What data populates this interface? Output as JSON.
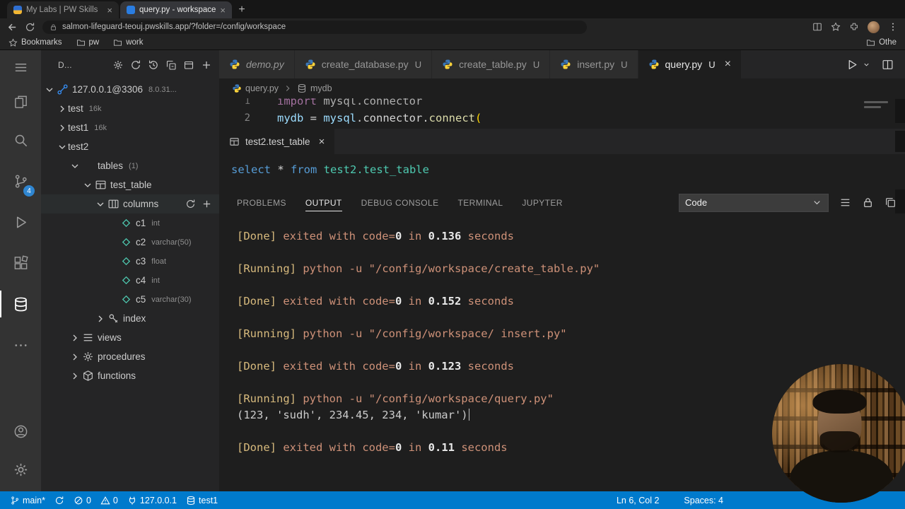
{
  "colors": {
    "statusbar": "#007acc",
    "badge": "#2f86d1",
    "keyword_blue": "#569cd6",
    "entity_teal": "#4ec9b0",
    "string_orange": "#ce9178",
    "tag_yellow": "#d7ba7d"
  },
  "browser": {
    "tabs": [
      {
        "title": "My Labs | PW Skills",
        "favicon": "pw",
        "active": false
      },
      {
        "title": "query.py - workspace - code-se",
        "favicon": "code",
        "active": true
      }
    ],
    "url": "salmon-lifeguard-teouj.pwskills.app/?folder=/config/workspace",
    "bookmarks": [
      {
        "label": "Bookmarks",
        "icon": "star"
      },
      {
        "label": "pw",
        "icon": "folder"
      },
      {
        "label": "work",
        "icon": "folder"
      },
      {
        "label": "Othe",
        "icon": "folder"
      }
    ]
  },
  "activity_bar": {
    "items": [
      {
        "name": "menu",
        "icon": "menu"
      },
      {
        "name": "explorer",
        "icon": "files"
      },
      {
        "name": "search",
        "icon": "search"
      },
      {
        "name": "source-control",
        "icon": "branch",
        "badge": "4"
      },
      {
        "name": "run-debug",
        "icon": "run"
      },
      {
        "name": "extensions",
        "icon": "extensions"
      },
      {
        "name": "database",
        "icon": "database",
        "active": true
      },
      {
        "name": "more",
        "icon": "more"
      }
    ],
    "bottom": [
      {
        "name": "account",
        "icon": "account"
      },
      {
        "name": "settings",
        "icon": "gear"
      }
    ]
  },
  "sidebar": {
    "title": "D...",
    "actions": [
      "gear",
      "refresh",
      "history",
      "collapse",
      "window",
      "add"
    ],
    "tree": [
      {
        "indent": 0,
        "chevron": "down",
        "icon": "connection",
        "label": "127.0.0.1@3306",
        "meta": "8.0.31..."
      },
      {
        "indent": 1,
        "chevron": "right",
        "label": "test",
        "meta": "16k"
      },
      {
        "indent": 1,
        "chevron": "right",
        "label": "test1",
        "meta": "16k"
      },
      {
        "indent": 1,
        "chevron": "down",
        "label": "test2"
      },
      {
        "indent": 2,
        "chevron": "down",
        "icon": "table-orange",
        "label": "tables",
        "meta": "(1)"
      },
      {
        "indent": 3,
        "chevron": "down",
        "icon": "table",
        "label": "test_table"
      },
      {
        "indent": 4,
        "chevron": "down",
        "icon": "columns",
        "label": "columns",
        "actions": [
          "refresh",
          "add"
        ],
        "selected": true
      },
      {
        "indent": 5,
        "icon": "field",
        "label": "c1",
        "meta": "int"
      },
      {
        "indent": 5,
        "icon": "field",
        "label": "c2",
        "meta": "varchar(50)"
      },
      {
        "indent": 5,
        "icon": "field",
        "label": "c3",
        "meta": "float"
      },
      {
        "indent": 5,
        "icon": "field",
        "label": "c4",
        "meta": "int"
      },
      {
        "indent": 5,
        "icon": "field",
        "label": "c5",
        "meta": "varchar(30)"
      },
      {
        "indent": 4,
        "chevron": "right",
        "icon": "key",
        "label": "index"
      },
      {
        "indent": 2,
        "chevron": "right",
        "icon": "list",
        "label": "views"
      },
      {
        "indent": 2,
        "chevron": "right",
        "icon": "gear",
        "label": "procedures"
      },
      {
        "indent": 2,
        "chevron": "right",
        "icon": "cube",
        "label": "functions"
      }
    ]
  },
  "editor": {
    "tabs": [
      {
        "name": "demo.py",
        "italic": true
      },
      {
        "name": "create_database.py",
        "flag": "U"
      },
      {
        "name": "create_table.py",
        "flag": "U"
      },
      {
        "name": "insert.py",
        "flag": "U"
      },
      {
        "name": "query.py",
        "flag": "U",
        "active": true
      }
    ],
    "breadcrumb": [
      {
        "label": "query.py",
        "icon": "python"
      },
      {
        "label": "mydb",
        "icon": "database"
      }
    ],
    "code_lines": [
      {
        "num": "1",
        "dim": true,
        "tokens": [
          {
            "s": "import",
            "c": "kw2"
          },
          {
            "s": " mysql.connector",
            "c": "plain"
          }
        ]
      },
      {
        "num": "2",
        "tokens": [
          {
            "s": "mydb",
            "c": "var"
          },
          {
            "s": " = ",
            "c": "plain"
          },
          {
            "s": "mysql",
            "c": "var"
          },
          {
            "s": ".connector.",
            "c": "plain"
          },
          {
            "s": "connect",
            "c": "fn"
          },
          {
            "s": "(",
            "c": "brk"
          }
        ]
      }
    ]
  },
  "results_editor": {
    "tab": "test2.test_table",
    "sql_tokens": [
      {
        "s": "select",
        "c": "kw"
      },
      {
        "s": " * ",
        "c": "plain"
      },
      {
        "s": "from",
        "c": "kw"
      },
      {
        "s": " test2.test_table",
        "c": "entity"
      }
    ]
  },
  "panel": {
    "tabs": [
      {
        "label": "PROBLEMS"
      },
      {
        "label": "OUTPUT",
        "active": true
      },
      {
        "label": "DEBUG CONSOLE"
      },
      {
        "label": "TERMINAL"
      },
      {
        "label": "JUPYTER"
      }
    ],
    "channel": "Code",
    "output": [
      {
        "parts": [
          {
            "s": "[Done]",
            "c": "b"
          },
          {
            "s": " exited with code=",
            "c": "t"
          },
          {
            "s": "0",
            "c": "n"
          },
          {
            "s": " in ",
            "c": "t"
          },
          {
            "s": "0.136",
            "c": "n"
          },
          {
            "s": " seconds",
            "c": "t"
          }
        ]
      },
      {
        "parts": []
      },
      {
        "parts": [
          {
            "s": "[Running]",
            "c": "b"
          },
          {
            "s": " python -u \"/config/workspace/create_table.py\"",
            "c": "t"
          }
        ]
      },
      {
        "parts": []
      },
      {
        "parts": [
          {
            "s": "[Done]",
            "c": "b"
          },
          {
            "s": " exited with code=",
            "c": "t"
          },
          {
            "s": "0",
            "c": "n"
          },
          {
            "s": " in ",
            "c": "t"
          },
          {
            "s": "0.152",
            "c": "n"
          },
          {
            "s": " seconds",
            "c": "t"
          }
        ]
      },
      {
        "parts": []
      },
      {
        "parts": [
          {
            "s": "[Running]",
            "c": "b"
          },
          {
            "s": " python -u \"/config/workspace/ insert.py\"",
            "c": "t"
          }
        ]
      },
      {
        "parts": []
      },
      {
        "parts": [
          {
            "s": "[Done]",
            "c": "b"
          },
          {
            "s": " exited with code=",
            "c": "t"
          },
          {
            "s": "0",
            "c": "n"
          },
          {
            "s": " in ",
            "c": "t"
          },
          {
            "s": "0.123",
            "c": "n"
          },
          {
            "s": " seconds",
            "c": "t"
          }
        ]
      },
      {
        "parts": []
      },
      {
        "parts": [
          {
            "s": "[Running]",
            "c": "b"
          },
          {
            "s": " python -u \"/config/workspace/query.py\"",
            "c": "t"
          }
        ]
      },
      {
        "parts": [
          {
            "s": "(123, 'sudh', 234.45, 234, 'kumar')",
            "c": "p"
          }
        ],
        "cursor": true
      },
      {
        "parts": []
      },
      {
        "parts": [
          {
            "s": "[Done]",
            "c": "b"
          },
          {
            "s": " exited with code=",
            "c": "t"
          },
          {
            "s": "0",
            "c": "n"
          },
          {
            "s": " in ",
            "c": "t"
          },
          {
            "s": "0.11",
            "c": "n"
          },
          {
            "s": " seconds",
            "c": "t"
          }
        ]
      }
    ]
  },
  "status_bar": {
    "left": [
      {
        "name": "branch",
        "icon": "branch",
        "label": "main*"
      },
      {
        "name": "sync",
        "icon": "refresh",
        "label": ""
      },
      {
        "name": "problems",
        "icon": "error",
        "label": "0"
      },
      {
        "name": "warnings",
        "icon": "warning",
        "label": "0"
      },
      {
        "name": "server",
        "icon": "plug",
        "label": "127.0.0.1"
      },
      {
        "name": "database",
        "icon": "database",
        "label": "test1"
      }
    ],
    "right": [
      {
        "name": "cursor-position",
        "label": "Ln 6, Col 2"
      },
      {
        "name": "indentation",
        "label": "Spaces: 4"
      }
    ]
  }
}
